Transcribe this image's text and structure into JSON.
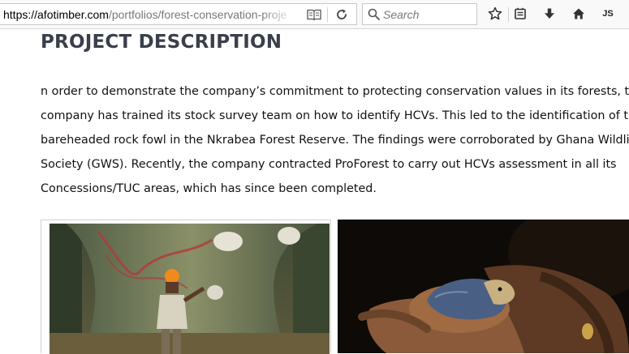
{
  "browser": {
    "url_host": "https://afotimber.com",
    "url_path": "/portfolios/forest-conservation-proje",
    "search_placeholder": "Search",
    "account_initials": "JS",
    "icons": [
      "reader-view-icon",
      "reload-icon",
      "search-icon",
      "bookmark-star-icon",
      "library-icon",
      "download-icon",
      "home-icon"
    ]
  },
  "page": {
    "title": "PROJECT DESCRIPTION",
    "description_lines": [
      "n order to demonstrate the company’s commitment to protecting conservation values in its forests, the",
      "company has trained its stock survey team on how to identify HCVs. This led to the identification of the",
      "bareheaded rock fowl in the Nkrabea Forest Reserve. The findings were corroborated by Ghana Wildlife",
      "Society (GWS). Recently, the company contracted ProForest to carry out HCVs assessment in all its",
      "Concessions/TUC areas, which has since been completed."
    ],
    "photos": [
      "photo-worker-by-tree",
      "photo-bird-chick-in-hands"
    ]
  },
  "colors": {
    "title": "#3a3f4b",
    "toolbar_bg": "#f9f9fa",
    "text": "#111111"
  }
}
